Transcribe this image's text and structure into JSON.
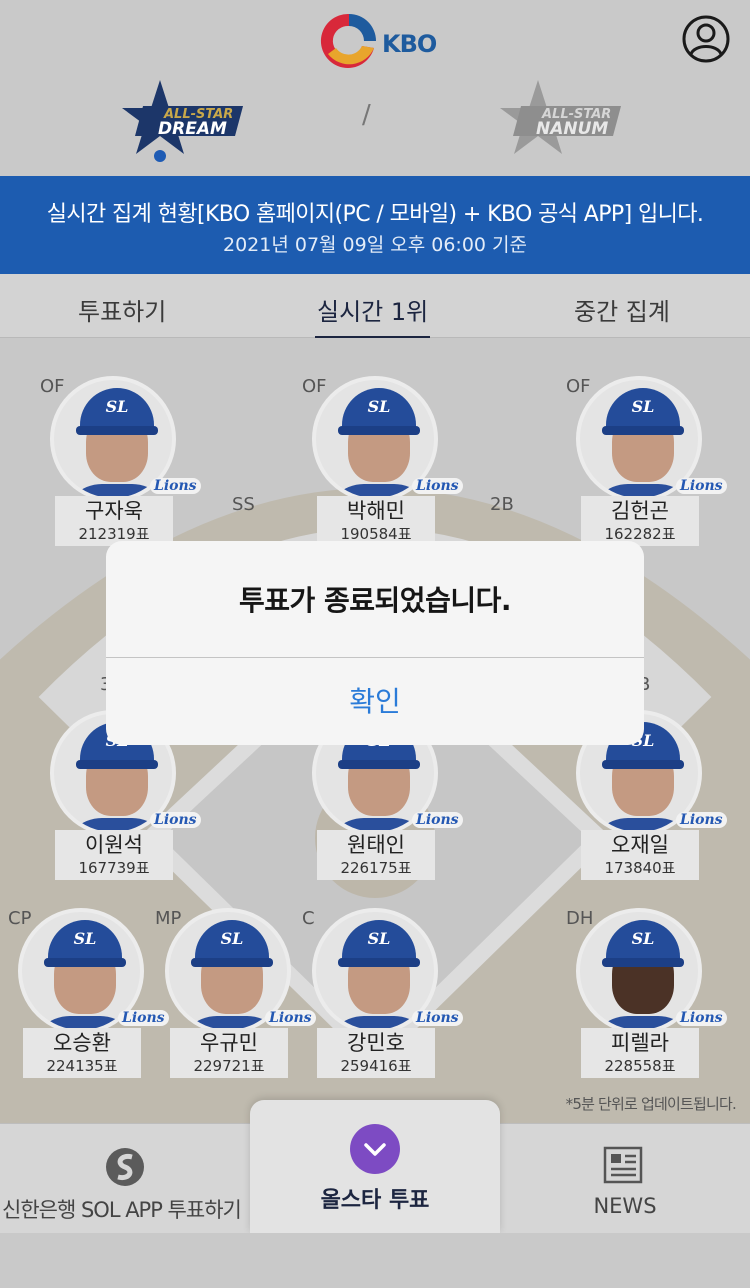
{
  "header": {
    "logo_text": "KBO",
    "team_dream": "DREAM",
    "team_nanum": "NANUM",
    "allstar_text": "ALL-STAR",
    "separator": "/"
  },
  "banner": {
    "line1": "실시간 집계 현황[KBO 홈페이지(PC / 모바일) + KBO 공식 APP] 입니다.",
    "line2": "2021년 07월 09일 오후 06:00 기준"
  },
  "tabs": [
    {
      "label": "투표하기"
    },
    {
      "label": "실시간 1위",
      "active": true
    },
    {
      "label": "중간 집계"
    }
  ],
  "players": [
    {
      "pos": "OF",
      "name": "구자욱",
      "votes": "212319표"
    },
    {
      "pos": "OF",
      "name": "박해민",
      "votes": "190584표"
    },
    {
      "pos": "OF",
      "name": "김헌곤",
      "votes": "162282표"
    },
    {
      "pos": "SS"
    },
    {
      "pos": "2B"
    },
    {
      "pos": "3"
    },
    {
      "pos": "B"
    },
    {
      "name": "이원석",
      "votes": "167739표"
    },
    {
      "name": "원태인",
      "votes": "226175표"
    },
    {
      "name": "오재일",
      "votes": "173840표"
    },
    {
      "pos": "CP",
      "name": "오승환",
      "votes": "224135표"
    },
    {
      "pos": "MP",
      "name": "우규민",
      "votes": "229721표"
    },
    {
      "pos": "C",
      "name": "강민호",
      "votes": "259416표"
    },
    {
      "pos": "DH",
      "name": "피렐라",
      "votes": "228558표"
    }
  ],
  "team_badge": "Lions",
  "update_note": "*5분 단위로 업데이트됩니다.",
  "bottom_nav": {
    "sol": "신한은행 SOL APP 투표하기",
    "allstar": "올스타 투표",
    "news": "NEWS"
  },
  "dialog": {
    "message": "투표가 종료되었습니다.",
    "confirm": "확인"
  },
  "colors": {
    "banner": "#1d5cb0",
    "confirm": "#2a7bd8",
    "allstar_button": "#7d4bc3",
    "cap": "#244c9a"
  },
  "icons": [
    "profile-icon",
    "sol-icon",
    "chevron-down-icon",
    "news-icon"
  ]
}
